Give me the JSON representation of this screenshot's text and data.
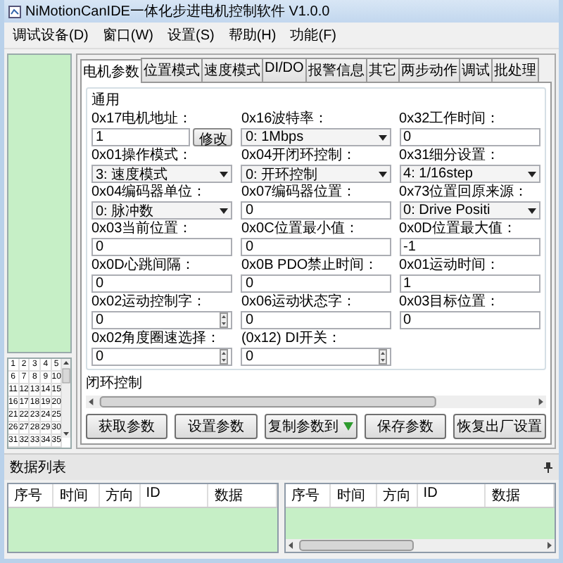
{
  "window": {
    "title": "NiMotionCanIDE一体化步进电机控制软件 V1.0.0"
  },
  "menu": [
    "调试设备(D)",
    "窗口(W)",
    "设置(S)",
    "帮助(H)",
    "功能(F)"
  ],
  "grid": {
    "cells": [
      "1",
      "2",
      "3",
      "4",
      "5",
      "6",
      "7",
      "8",
      "9",
      "10",
      "11",
      "12",
      "13",
      "14",
      "15",
      "16",
      "17",
      "18",
      "19",
      "20",
      "21",
      "22",
      "23",
      "24",
      "25",
      "26",
      "27",
      "28",
      "29",
      "30",
      "31",
      "32",
      "33",
      "34",
      "35"
    ]
  },
  "tabs": [
    {
      "label": "电机参数",
      "selected": true
    },
    {
      "label": "位置模式",
      "selected": false
    },
    {
      "label": "速度模式",
      "selected": false
    },
    {
      "label": "DI/DO",
      "selected": false
    },
    {
      "label": "报警信息",
      "selected": false
    },
    {
      "label": "其它",
      "selected": false
    },
    {
      "label": "两步动作",
      "selected": false
    },
    {
      "label": "调试",
      "selected": false
    },
    {
      "label": "批处理",
      "selected": false
    }
  ],
  "params": {
    "group_title": "通用",
    "rows": [
      [
        {
          "label": "0x17电机地址：",
          "kind": "text",
          "value": "1",
          "button": "修改"
        },
        {
          "label": "0x16波特率：",
          "kind": "combo",
          "value": "0: 1Mbps"
        },
        {
          "label": "0x32工作时间：",
          "kind": "text",
          "value": "0"
        }
      ],
      [
        {
          "label": "0x01操作模式：",
          "kind": "combo",
          "value": "3: 速度模式"
        },
        {
          "label": "0x04开闭环控制：",
          "kind": "combo",
          "value": "0: 开环控制"
        },
        {
          "label": "0x31细分设置：",
          "kind": "combo",
          "value": "4: 1/16step"
        }
      ],
      [
        {
          "label": "0x04编码器单位：",
          "kind": "combo",
          "value": "0: 脉冲数"
        },
        {
          "label": "0x07编码器位置：",
          "kind": "text",
          "value": "0"
        },
        {
          "label": "0x73位置回原来源：",
          "kind": "combo",
          "value": "0: Drive Positi"
        }
      ],
      [
        {
          "label": "0x03当前位置：",
          "kind": "text",
          "value": "0"
        },
        {
          "label": "0x0C位置最小值：",
          "kind": "text",
          "value": "0"
        },
        {
          "label": "0x0D位置最大值：",
          "kind": "text",
          "value": "-1"
        }
      ],
      [
        {
          "label": "0x0D心跳间隔：",
          "kind": "text",
          "value": "0"
        },
        {
          "label": "0x0B PDO禁止时间：",
          "kind": "text",
          "value": "0"
        },
        {
          "label": "0x01运动时间：",
          "kind": "text",
          "value": "1"
        }
      ],
      [
        {
          "label": "0x02运动控制字：",
          "kind": "spin",
          "value": "0"
        },
        {
          "label": "0x06运动状态字：",
          "kind": "text",
          "value": "0"
        },
        {
          "label": "0x03目标位置：",
          "kind": "text",
          "value": "0"
        }
      ],
      [
        {
          "label": "0x02角度圈速选择：",
          "kind": "spin",
          "value": "0"
        },
        {
          "label": "(0x12) DI开关：",
          "kind": "spin",
          "value": "0"
        }
      ]
    ],
    "section_title": "闭环控制"
  },
  "buttons": [
    {
      "label": "获取参数",
      "dropdown": false
    },
    {
      "label": "设置参数",
      "dropdown": false
    },
    {
      "label": "复制参数到",
      "dropdown": true
    },
    {
      "label": "保存参数",
      "dropdown": false
    },
    {
      "label": "恢复出厂设置",
      "dropdown": false
    }
  ],
  "data_list": {
    "title": "数据列表",
    "tables": [
      {
        "columns": [
          "序号",
          "时间",
          "方向",
          "ID",
          "数据"
        ],
        "scrollbar": false
      },
      {
        "columns": [
          "序号",
          "时间",
          "方向",
          "ID",
          "数据"
        ],
        "scrollbar": true
      }
    ]
  }
}
